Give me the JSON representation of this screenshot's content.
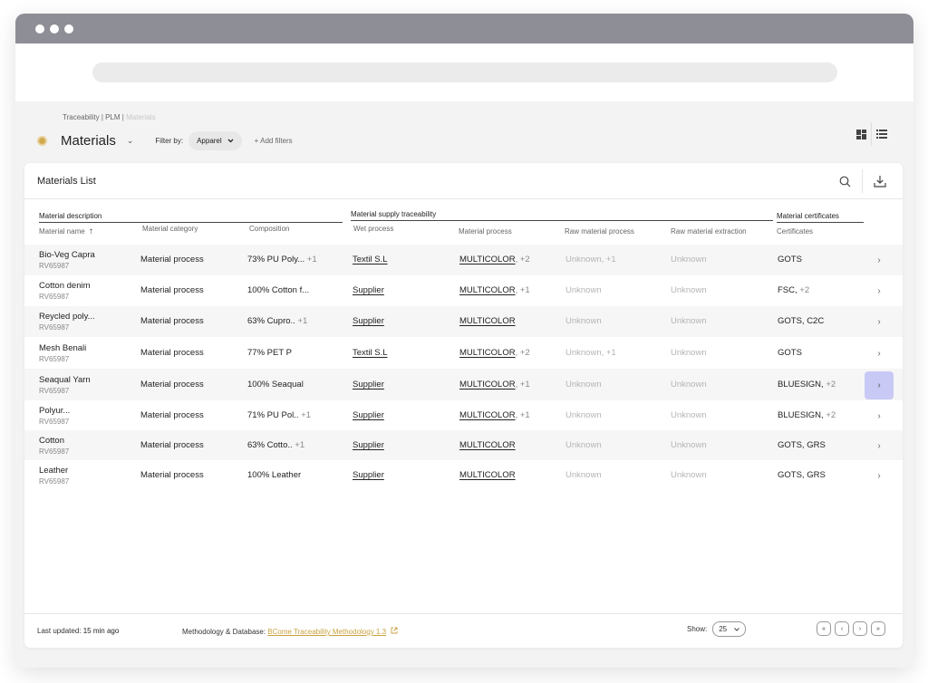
{
  "breadcrumb": {
    "part1": "Traceability | PLM | ",
    "current": "Materials"
  },
  "page": {
    "title": "Materials",
    "filter_label": "Filter by:",
    "filter_value": "Apparel",
    "add_filters": "+ Add filters"
  },
  "panel": {
    "title": "Materials List"
  },
  "groups": {
    "description": "Material description",
    "supply": "Material supply traceability",
    "certificates": "Material certificates"
  },
  "columns": {
    "name": "Material name",
    "category": "Material category",
    "composition": "Composition",
    "wet": "Wet process",
    "process": "Material process",
    "raw_process": "Raw material process",
    "raw_extraction": "Raw material extraction",
    "certificates": "Certificates"
  },
  "rows": [
    {
      "name": "Bio-Veg Capra",
      "code": "RV65987",
      "category": "Material process",
      "composition": "73% PU Poly...",
      "comp_more": "+1",
      "wet": "Textil S.L",
      "process": "MULTICOLOR",
      "process_more": ", +2",
      "raw_process": "Unknown, +1",
      "raw_extraction": "Unknown",
      "cert": "GOTS",
      "cert_more": ""
    },
    {
      "name": "Cotton denim",
      "code": "RV65987",
      "category": "Material process",
      "composition": "100% Cotton f...",
      "comp_more": "",
      "wet": "Supplier",
      "process": "MULTICOLOR",
      "process_more": ", +1",
      "raw_process": "Unknown",
      "raw_extraction": "Unknown",
      "cert": "FSC,",
      "cert_more": " +2"
    },
    {
      "name": "Reycled poly...",
      "code": "RV65987",
      "category": "Material process",
      "composition": "63% Cupro..",
      "comp_more": "+1",
      "wet": "Supplier",
      "process": "MULTICOLOR",
      "process_more": "",
      "raw_process": "Unknown",
      "raw_extraction": "Unknown",
      "cert": "GOTS, C2C",
      "cert_more": ""
    },
    {
      "name": "Mesh Benali",
      "code": "RV65987",
      "category": "Material process",
      "composition": "77% PET P",
      "comp_more": "",
      "wet": "Textil S.L",
      "process": "MULTICOLOR",
      "process_more": ", +2",
      "raw_process": "Unknown, +1",
      "raw_extraction": "Unknown",
      "cert": "GOTS",
      "cert_more": ""
    },
    {
      "name": "Seaqual Yarn",
      "code": "RV65987",
      "category": "Material process",
      "composition": "100% Seaqual",
      "comp_more": "",
      "wet": "Supplier",
      "process": "MULTICOLOR",
      "process_more": ", +1",
      "raw_process": "Unknown",
      "raw_extraction": "Unknown",
      "cert": "BLUESIGN,",
      "cert_more": " +2"
    },
    {
      "name": "Polyur...",
      "code": "RV65987",
      "category": "Material process",
      "composition": "71% PU Pol..",
      "comp_more": "+1",
      "wet": "Supplier",
      "process": "MULTICOLOR",
      "process_more": ", +1",
      "raw_process": "Unknown",
      "raw_extraction": "Unknown",
      "cert": "BLUESIGN,",
      "cert_more": " +2"
    },
    {
      "name": "Cotton",
      "code": "RV65987",
      "category": "Material process",
      "composition": "63% Cotto..",
      "comp_more": "+1",
      "wet": "Supplier",
      "process": "MULTICOLOR",
      "process_more": "",
      "raw_process": "Unknown",
      "raw_extraction": "Unknown",
      "cert": "GOTS, GRS",
      "cert_more": ""
    },
    {
      "name": "Leather",
      "code": "RV65987",
      "category": "Material process",
      "composition": "100% Leather",
      "comp_more": "",
      "wet": "Supplier",
      "process": "MULTICOLOR",
      "process_more": "",
      "raw_process": "Unknown",
      "raw_extraction": "Unknown",
      "cert": "GOTS, GRS",
      "cert_more": ""
    }
  ],
  "footer": {
    "last_updated_label": "Last updated:",
    "last_updated_value": "15 min ago",
    "methodology_label": "Methodology & Database:",
    "methodology_link": "BCome Traceability Methodology 1.3",
    "show_label": "Show:",
    "show_value": "25"
  }
}
